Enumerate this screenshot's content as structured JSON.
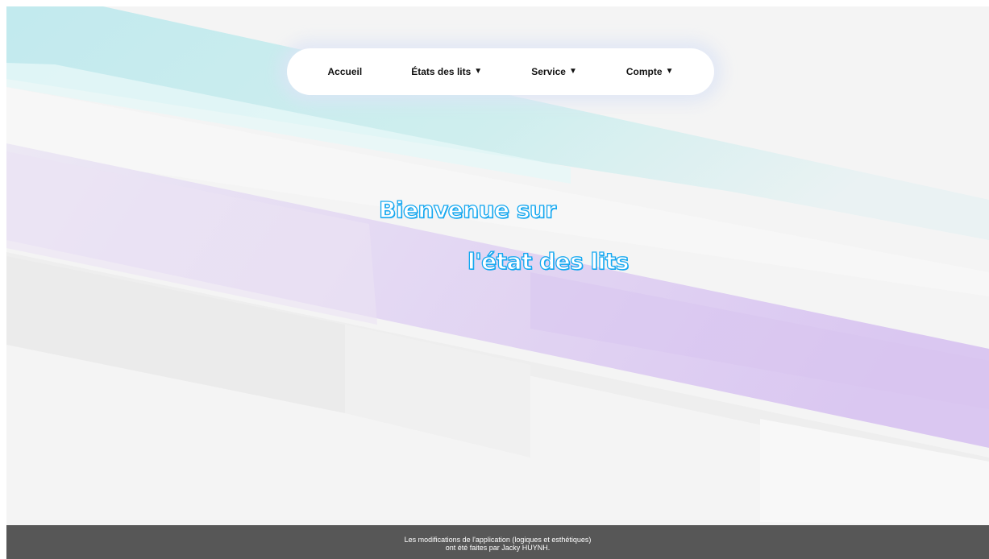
{
  "nav": {
    "items": [
      {
        "label": "Accueil",
        "has_dropdown": false
      },
      {
        "label": "États des lits",
        "has_dropdown": true
      },
      {
        "label": "Service",
        "has_dropdown": true
      },
      {
        "label": "Compte",
        "has_dropdown": true
      }
    ],
    "dropdown_glyph": "▼"
  },
  "hero": {
    "line1": "Bienvenue sur",
    "line2": "l'état des lits",
    "color": "#16a8f0"
  },
  "footer": {
    "line1": "Les modifications de l'application (logiques et esthétiques)",
    "line2": "ont été faites par Jacky HUYNH.",
    "background": "#575757"
  },
  "background": {
    "page": "#f4f4f4",
    "teal_band": "#bfe9ee",
    "purple_band": "#dccbf2"
  }
}
